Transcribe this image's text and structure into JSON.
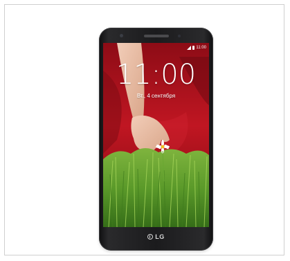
{
  "phone": {
    "status_time": "11:00",
    "clock": "11:00",
    "date": "Вт., 4 сентября",
    "brand": "LG"
  },
  "colors": {
    "frame_border": "#cfcfcf",
    "phone_body": "#1b1b1d",
    "wallpaper_red": "#b0101a",
    "grass_green": "#5b9a2a"
  },
  "icons": [
    "signal-icon",
    "battery-icon",
    "lg-logo-icon"
  ]
}
